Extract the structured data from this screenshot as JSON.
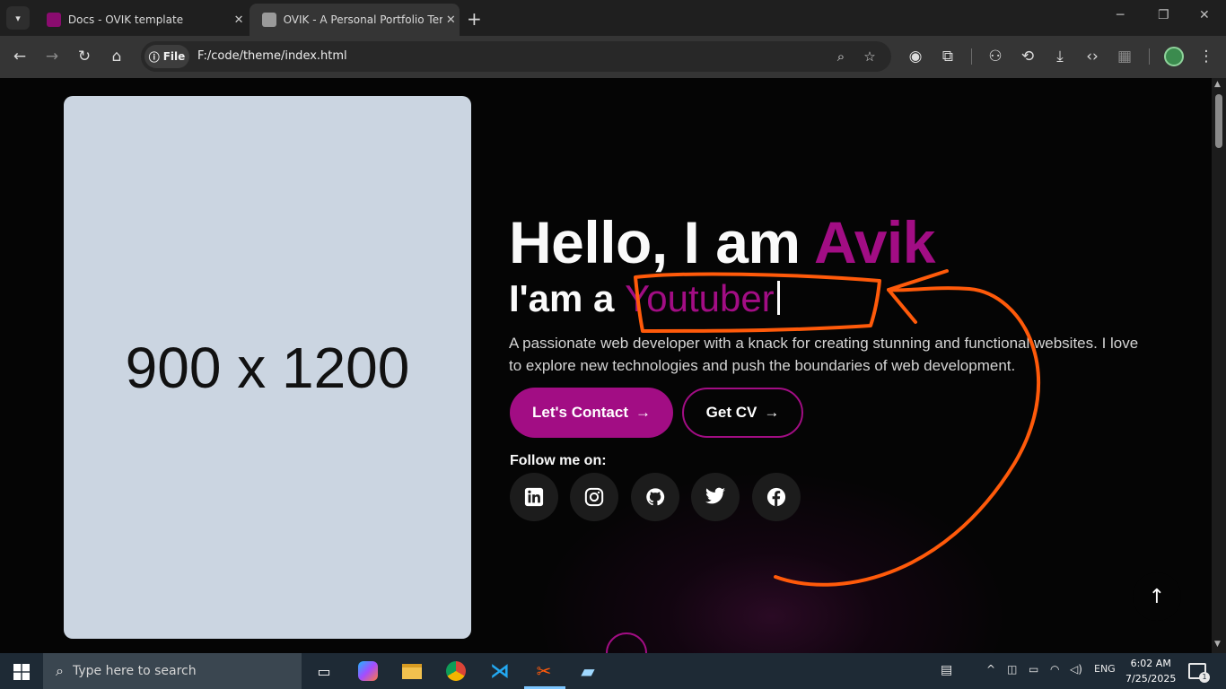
{
  "browser": {
    "tabs": [
      {
        "title": "Docs - OVIK template",
        "active": false
      },
      {
        "title": "OVIK - A Personal Portfolio Tem",
        "active": true
      }
    ],
    "address": {
      "scheme_chip": "File",
      "url": "F:/code/theme/index.html"
    }
  },
  "page": {
    "image_placeholder": "900 x 1200",
    "hero": {
      "greeting": "Hello, I am ",
      "name": "Avik",
      "role_prefix": "I'am a ",
      "role_typed": "Youtuber",
      "description": "A passionate web developer with a knack for creating stunning and functional websites. I love to explore new technologies and push the boundaries of web development."
    },
    "buttons": {
      "contact": "Let's Contact",
      "cv": "Get CV"
    },
    "follow": {
      "label": "Follow me on:",
      "icons": [
        "linkedin-icon",
        "instagram-icon",
        "github-icon",
        "twitter-icon",
        "facebook-icon"
      ]
    },
    "colors": {
      "accent": "#a20d84",
      "annotation": "#ff5a0a"
    }
  },
  "taskbar": {
    "search_placeholder": "Type here to search",
    "language": "ENG",
    "time": "6:02 AM",
    "date": "7/25/2025",
    "notification_count": "1"
  }
}
